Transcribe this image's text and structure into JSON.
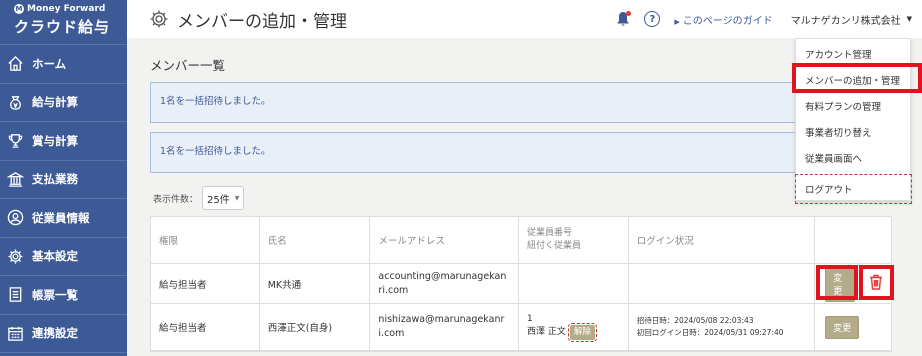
{
  "brand": {
    "company": "Money Forward",
    "product": "クラウド給与"
  },
  "sidebar": {
    "items": [
      {
        "label": "ホーム",
        "icon": "home-icon"
      },
      {
        "label": "給与計算",
        "icon": "money-bag-icon"
      },
      {
        "label": "賞与計算",
        "icon": "trophy-icon"
      },
      {
        "label": "支払業務",
        "icon": "bank-icon"
      },
      {
        "label": "従業員情報",
        "icon": "person-icon"
      },
      {
        "label": "基本設定",
        "icon": "gear-icon"
      },
      {
        "label": "帳票一覧",
        "icon": "document-icon"
      },
      {
        "label": "連携設定",
        "icon": "calendar-icon"
      }
    ]
  },
  "header": {
    "title": "メンバーの追加・管理",
    "guide": "このページのガイド",
    "help": "?",
    "company": "マルナゲカンリ株式会社"
  },
  "main": {
    "section_title": "メンバー一覧",
    "alerts": [
      "1名を一括招待しました。",
      "1名を一括招待しました。"
    ],
    "per_page_label": "表示件数：",
    "per_page_value": "25件"
  },
  "table": {
    "headers": [
      "権限",
      "氏名",
      "メールアドレス",
      "従業員番号",
      "紐付く従業員",
      "ログイン状況"
    ],
    "rows": [
      {
        "role": "給与担当者",
        "name": "MK共通",
        "email": "accounting@marunagekanri.com",
        "change": "変更"
      },
      {
        "role": "給与担当者",
        "name": "西澤正文(自身)",
        "email": "nishizawa@marunagekanri.com",
        "emp_no": "1",
        "linked": "西澤 正文",
        "release": "解除",
        "invited": "招待日時：2024/05/08 22:03:43",
        "first_login": "初回ログイン日時：2024/05/31 09:27:40",
        "change": "変更"
      }
    ]
  },
  "dropdown": {
    "items": [
      "アカウント管理",
      "メンバーの追加・管理",
      "有料プランの管理",
      "事業者切り替え",
      "従業員画面へ",
      "ログアウト"
    ]
  },
  "colors": {
    "sidebar": "#3d5a96",
    "highlight": "#e0141e",
    "button": "#b3ab8a"
  }
}
